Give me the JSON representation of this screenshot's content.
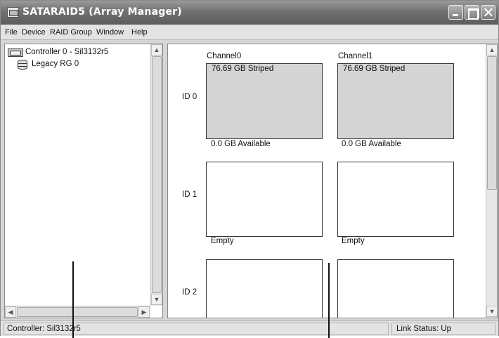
{
  "window": {
    "title": "SATARAID5 (Array Manager)"
  },
  "menubar": {
    "items": [
      "File",
      "Device",
      "RAID Group",
      "Window",
      "Help"
    ]
  },
  "tree": {
    "controller": "Controller 0 - Sil3132r5",
    "group": "Legacy RG 0"
  },
  "grid": {
    "channels": [
      "Channel0",
      "Channel1"
    ],
    "rows": [
      {
        "id": "ID 0",
        "slots": [
          {
            "state": "filled",
            "top": "76.69 GB Striped",
            "status": "0.0 GB Available"
          },
          {
            "state": "filled",
            "top": "76.69 GB Striped",
            "status": "0.0 GB Available"
          }
        ]
      },
      {
        "id": "ID 1",
        "slots": [
          {
            "state": "empty",
            "top": "",
            "status": "Empty"
          },
          {
            "state": "empty",
            "top": "",
            "status": "Empty"
          }
        ]
      },
      {
        "id": "ID 2",
        "slots": [
          {
            "state": "empty",
            "top": "",
            "status": ""
          },
          {
            "state": "empty",
            "top": "",
            "status": ""
          }
        ]
      }
    ]
  },
  "statusbar": {
    "left": "Controller: Sil3132r5",
    "right": "Link Status: Up"
  },
  "colors": {
    "filled_slot": "#d4d4d4",
    "titlebar": "#6f6f6f"
  }
}
